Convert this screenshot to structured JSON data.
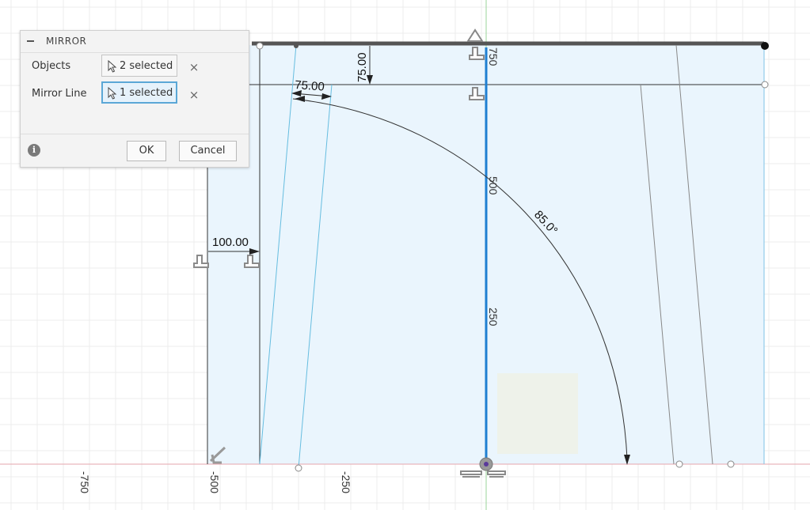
{
  "dialog": {
    "title": "MIRROR",
    "objects_label": "Objects",
    "objects_value": "2 selected",
    "mirror_line_label": "Mirror Line",
    "mirror_line_value": "1 selected",
    "clear_glyph": "×",
    "info_glyph": "i",
    "ok_label": "OK",
    "cancel_label": "Cancel"
  },
  "sketch": {
    "dimensions": {
      "top_offset": "75.00",
      "angled_offset": "75.00",
      "left_offset": "100.00",
      "angle": "85.0°"
    },
    "axis_labels": {
      "x_neg_750": "-750",
      "x_neg_500": "-500",
      "x_neg_250": "-250",
      "y_250": "250",
      "y_500": "500",
      "y_750": "750"
    },
    "colors": {
      "profile_fill": "#e9f4fc",
      "mirror_line": "#1f7fd1",
      "x_axis": "#e8a0a8",
      "y_axis": "#8fd58f",
      "grid": "#e8e8e8"
    },
    "icons": [
      "horizontal-constraint-icon",
      "coincident-constraint-icon",
      "fix-constraint-icon",
      "origin-icon"
    ]
  }
}
